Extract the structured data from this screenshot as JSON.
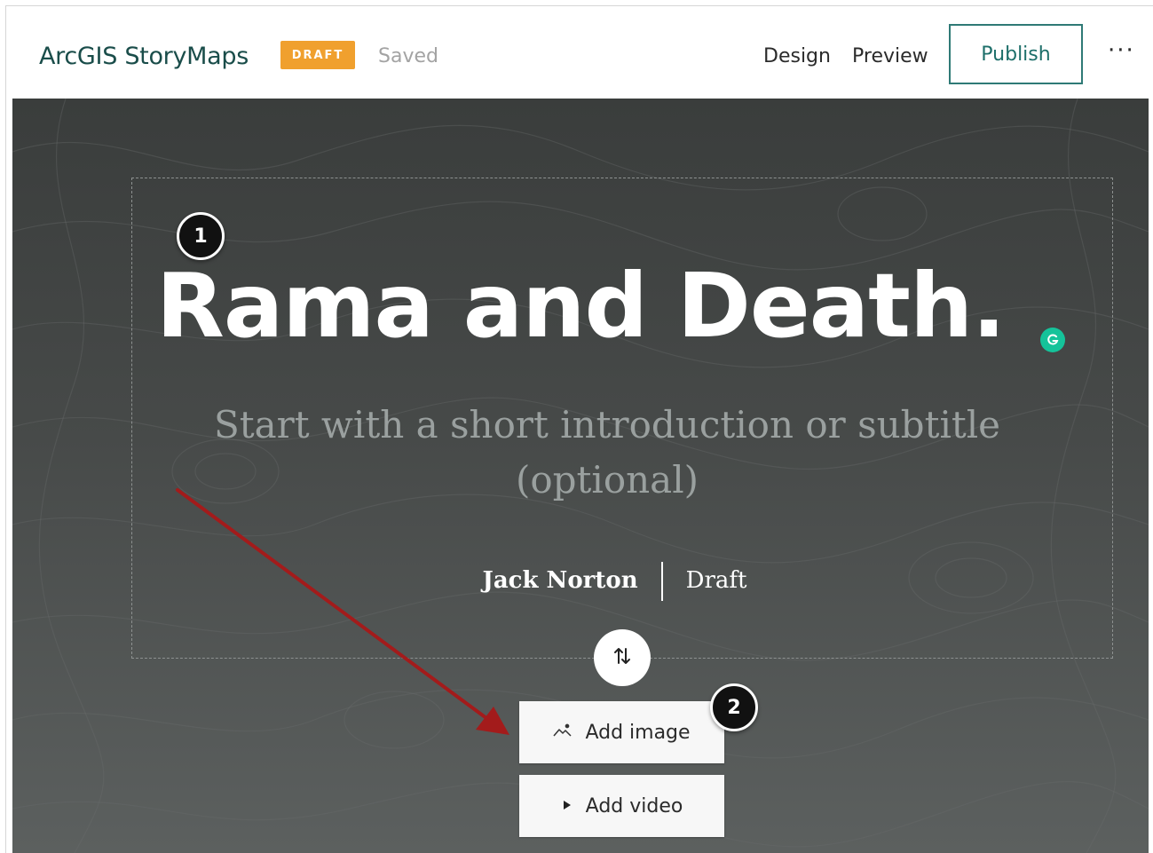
{
  "header": {
    "brand": "ArcGIS StoryMaps",
    "status_badge": "DRAFT",
    "save_status": "Saved",
    "nav": {
      "design": "Design",
      "preview": "Preview"
    },
    "publish_label": "Publish",
    "more_label": "···"
  },
  "story": {
    "title": "Rama and Death.",
    "subtitle": "Start with a short introduction or subtitle (optional)",
    "author": "Jack Norton",
    "status": "Draft"
  },
  "actions": {
    "add_image": "Add image",
    "add_video": "Add video"
  },
  "callouts": {
    "first": "1",
    "second": "2"
  },
  "colors": {
    "brand_text": "#1a4d4a",
    "draft_badge": "#f0a02e",
    "publish_border": "#2f7a76",
    "hero_background": "#474a49",
    "annotation_arrow": "#a31b1b",
    "grammarly": "#15c39a"
  },
  "icons": {
    "swap": "swap-vertical-icon",
    "add_image": "image-icon",
    "add_video": "play-icon",
    "grammarly": "grammarly-icon",
    "more": "more-horizontal-icon"
  }
}
